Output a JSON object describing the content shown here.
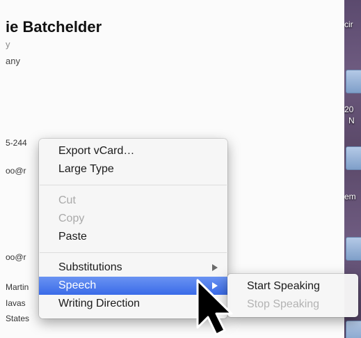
{
  "card": {
    "name": "ie Batchelder",
    "line1": "y",
    "line2": "any",
    "phone": "5-244",
    "email1": "oo@r",
    "email2": "oo@r",
    "address": [
      "Martin",
      "Iavas",
      "States"
    ]
  },
  "desktop": {
    "labels": [
      "cir",
      "20",
      "N",
      "em"
    ]
  },
  "context_menu": {
    "items": [
      {
        "label": "Export vCard…",
        "enabled": true
      },
      {
        "label": "Large Type",
        "enabled": true
      },
      {
        "label": "Cut",
        "enabled": false
      },
      {
        "label": "Copy",
        "enabled": false
      },
      {
        "label": "Paste",
        "enabled": true
      },
      {
        "label": "Substitutions",
        "enabled": true,
        "submenu": true
      },
      {
        "label": "Speech",
        "enabled": true,
        "submenu": true,
        "selected": true
      },
      {
        "label": "Writing Direction",
        "enabled": true,
        "submenu": true
      }
    ],
    "highlight_color": "#3a6be8"
  },
  "speech_submenu": {
    "items": [
      {
        "label": "Start Speaking",
        "enabled": true
      },
      {
        "label": "Stop Speaking",
        "enabled": false
      }
    ]
  },
  "pointer": {
    "icon": "arrow-cursor-icon"
  }
}
